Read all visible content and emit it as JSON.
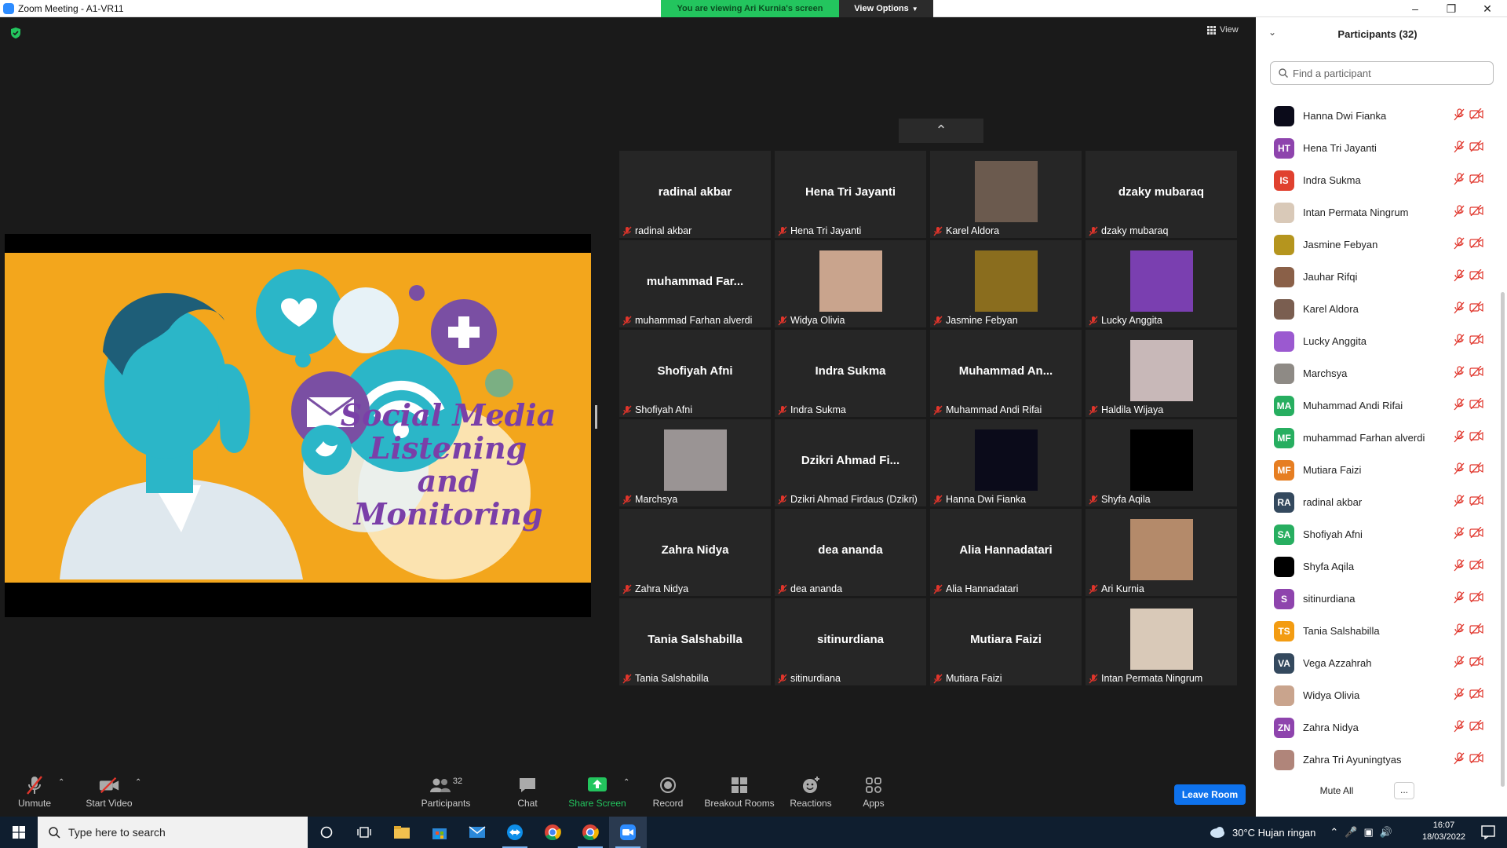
{
  "window": {
    "title": "Zoom Meeting - A1-VR11"
  },
  "banner": {
    "viewing": "You are viewing Ari Kurnia's screen",
    "view_options": "View Options"
  },
  "view_label": "View",
  "shared": {
    "line1": "Social Media",
    "line2": "Listening",
    "line3": "and",
    "line4": "Monitoring"
  },
  "tiles": [
    {
      "big": "radinal akbar",
      "name": "radinal akbar",
      "photo": false
    },
    {
      "big": "Hena Tri Jayanti",
      "name": "Hena Tri Jayanti",
      "photo": false
    },
    {
      "big": "",
      "name": "Karel Aldora",
      "photo": true,
      "color": "#6b5a4e"
    },
    {
      "big": "dzaky mubaraq",
      "name": "dzaky mubaraq",
      "photo": false
    },
    {
      "big": "muhammad Far...",
      "name": "muhammad Farhan alverdi",
      "photo": false
    },
    {
      "big": "",
      "name": "Widya Olivia",
      "photo": true,
      "color": "#c9a48d"
    },
    {
      "big": "",
      "name": "Jasmine Febyan",
      "photo": true,
      "color": "#8a6d1e"
    },
    {
      "big": "",
      "name": "Lucky Anggita",
      "photo": true,
      "color": "#7a3fb0"
    },
    {
      "big": "Shofiyah Afni",
      "name": "Shofiyah Afni",
      "photo": false
    },
    {
      "big": "Indra Sukma",
      "name": "Indra Sukma",
      "photo": false
    },
    {
      "big": "Muhammad An...",
      "name": "Muhammad Andi Rifai",
      "photo": false
    },
    {
      "big": "",
      "name": "Haldila Wijaya",
      "photo": true,
      "color": "#c8b8b8"
    },
    {
      "big": "",
      "name": "Marchsya",
      "photo": true,
      "color": "#9a9494"
    },
    {
      "big": "Dzikri Ahmad Fi...",
      "name": "Dzikri Ahmad Firdaus (Dzikri)",
      "photo": false
    },
    {
      "big": "",
      "name": "Hanna Dwi Fianka",
      "photo": true,
      "color": "#0b0b1a"
    },
    {
      "big": "",
      "name": "Shyfa Aqila",
      "photo": true,
      "color": "#000000"
    },
    {
      "big": "Zahra Nidya",
      "name": "Zahra Nidya",
      "photo": false
    },
    {
      "big": "dea ananda",
      "name": "dea ananda",
      "photo": false
    },
    {
      "big": "Alia Hannadatari",
      "name": "Alia Hannadatari",
      "photo": false
    },
    {
      "big": "",
      "name": "Ari Kurnia",
      "photo": true,
      "color": "#b48a6a"
    },
    {
      "big": "Tania Salshabilla",
      "name": "Tania Salshabilla",
      "photo": false
    },
    {
      "big": "sitinurdiana",
      "name": "sitinurdiana",
      "photo": false
    },
    {
      "big": "Mutiara Faizi",
      "name": "Mutiara Faizi",
      "photo": false
    },
    {
      "big": "",
      "name": "Intan Permata Ningrum",
      "photo": true,
      "color": "#d9c9b8"
    }
  ],
  "toolbar": {
    "unmute": "Unmute",
    "start_video": "Start Video",
    "participants": "Participants",
    "participants_count": "32",
    "chat": "Chat",
    "share_screen": "Share Screen",
    "record": "Record",
    "breakout": "Breakout Rooms",
    "reactions": "Reactions",
    "apps": "Apps",
    "leave": "Leave Room"
  },
  "panel": {
    "title": "Participants (32)",
    "search_placeholder": "Find a participant",
    "mute_all": "Mute All",
    "more": "...",
    "participants": [
      {
        "name": "Hanna Dwi Fianka",
        "initials": "",
        "color": "#0b0b1a"
      },
      {
        "name": "Hena Tri Jayanti",
        "initials": "HT",
        "color": "#8e44ad"
      },
      {
        "name": "Indra Sukma",
        "initials": "IS",
        "color": "#e0412f"
      },
      {
        "name": "Intan Permata Ningrum",
        "initials": "",
        "color": "#d9c9b8"
      },
      {
        "name": "Jasmine Febyan",
        "initials": "",
        "color": "#b5951e"
      },
      {
        "name": "Jauhar Rifqi",
        "initials": "",
        "color": "#8a6048"
      },
      {
        "name": "Karel Aldora",
        "initials": "",
        "color": "#7a5e50"
      },
      {
        "name": "Lucky Anggita",
        "initials": "",
        "color": "#9b59d0"
      },
      {
        "name": "Marchsya",
        "initials": "",
        "color": "#8e8a85"
      },
      {
        "name": "Muhammad Andi Rifai",
        "initials": "MA",
        "color": "#27ae60"
      },
      {
        "name": "muhammad Farhan alverdi",
        "initials": "MF",
        "color": "#27ae60"
      },
      {
        "name": "Mutiara Faizi",
        "initials": "MF",
        "color": "#e67e22"
      },
      {
        "name": "radinal akbar",
        "initials": "RA",
        "color": "#34495e"
      },
      {
        "name": "Shofiyah Afni",
        "initials": "SA",
        "color": "#27ae60"
      },
      {
        "name": "Shyfa Aqila",
        "initials": "",
        "color": "#000000"
      },
      {
        "name": "sitinurdiana",
        "initials": "S",
        "color": "#8e44ad"
      },
      {
        "name": "Tania Salshabilla",
        "initials": "TS",
        "color": "#f39c12"
      },
      {
        "name": "Vega Azzahrah",
        "initials": "VA",
        "color": "#34495e"
      },
      {
        "name": "Widya Olivia",
        "initials": "",
        "color": "#c9a48d"
      },
      {
        "name": "Zahra Nidya",
        "initials": "ZN",
        "color": "#8e44ad"
      },
      {
        "name": "Zahra Tri Ayuningtyas",
        "initials": "",
        "color": "#b0857a"
      }
    ]
  },
  "taskbar": {
    "search_placeholder": "Type here to search",
    "weather": "30°C  Hujan ringan",
    "time": "16:07",
    "date": "18/03/2022"
  }
}
